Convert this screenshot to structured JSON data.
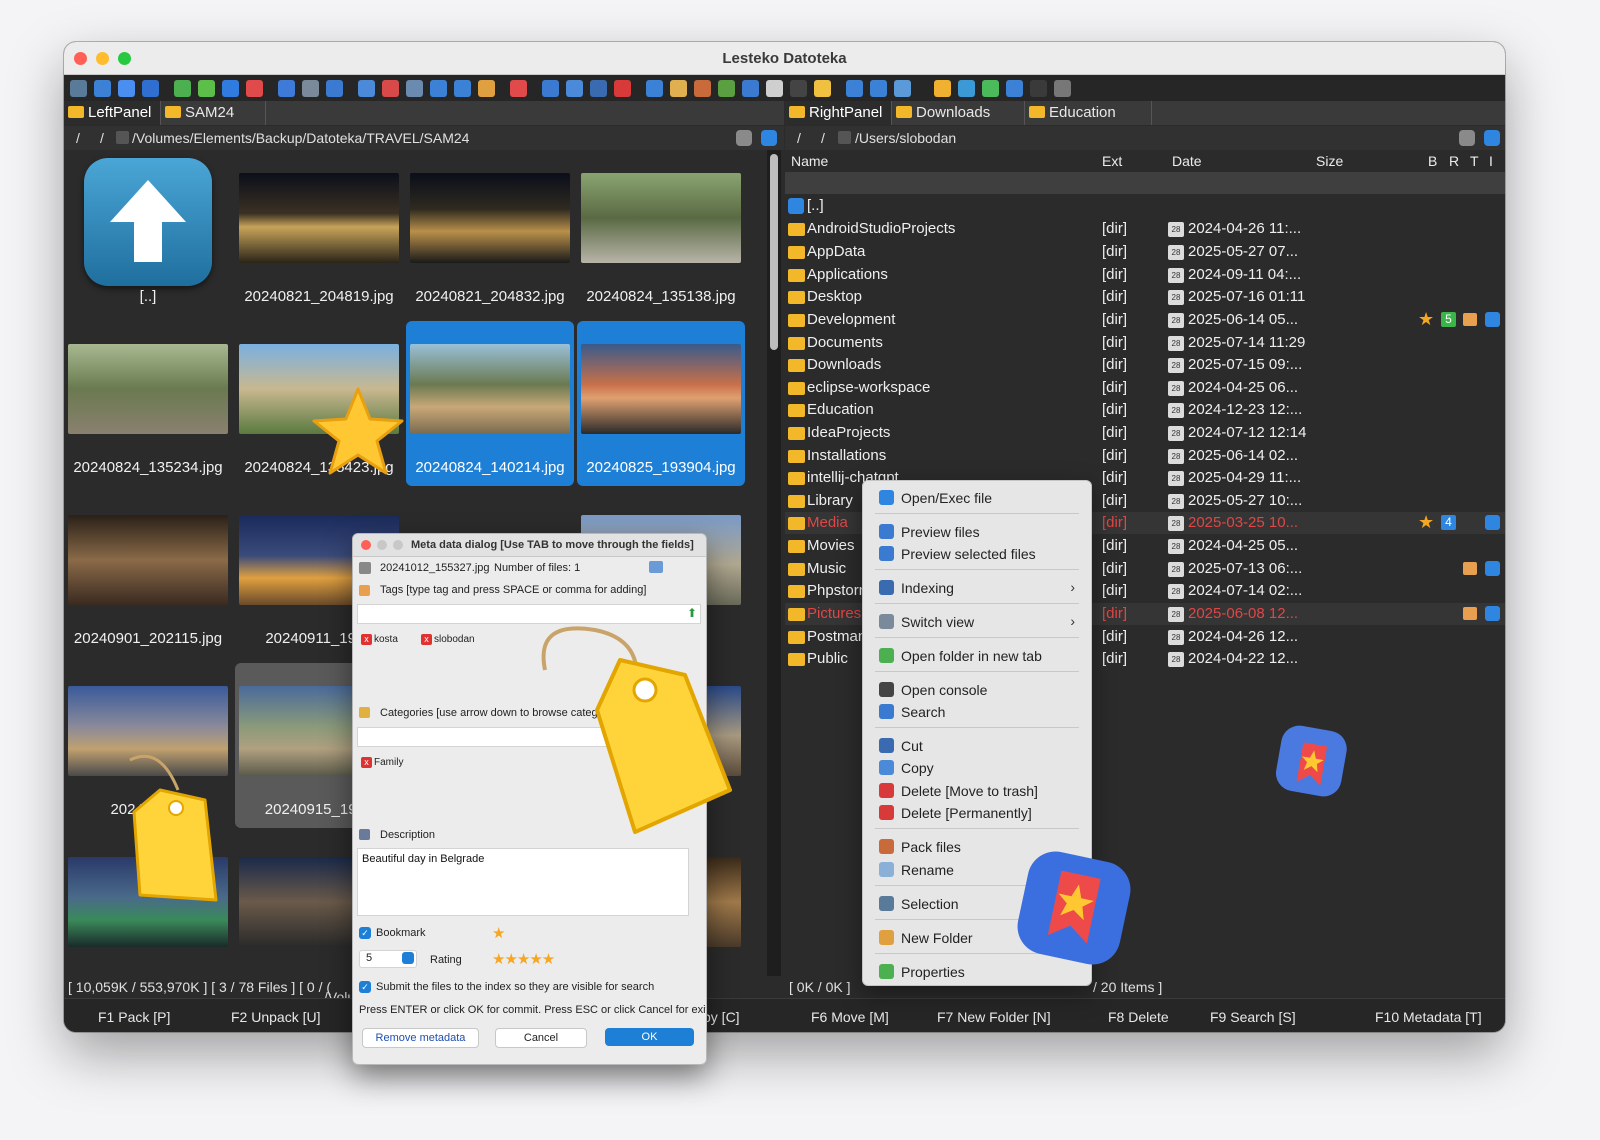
{
  "window": {
    "title": "Lesteko Datoteka"
  },
  "left": {
    "tabs": [
      "LeftPanel",
      "SAM24"
    ],
    "path_root": "/",
    "path_up": "/",
    "path": "/Volumes/Elements/Backup/Datoteka/TRAVEL/SAM24",
    "thumbnails": [
      {
        "name": "[..]"
      },
      {
        "name": "20240821_204819.jpg"
      },
      {
        "name": "20240821_204832.jpg"
      },
      {
        "name": "20240824_135138.jpg"
      },
      {
        "name": "20240824_135234.jpg"
      },
      {
        "name": "20240824_135423.jpg"
      },
      {
        "name": "20240824_140214.jpg"
      },
      {
        "name": "20240825_193904.jpg"
      },
      {
        "name": "20240901_202115.jpg"
      },
      {
        "name": "20240911_1928"
      },
      {
        "name": ""
      },
      {
        "name": "0.jpg"
      },
      {
        "name": "20240915_"
      },
      {
        "name": "20240915_1923"
      },
      {
        "name": ""
      },
      {
        "name": "0.jpg"
      }
    ],
    "status": "[ 10,059K / 553,970K ]    [ 3 / 78 Files ]    [ 0 / (",
    "status2": "/Volu"
  },
  "right": {
    "tabs": [
      "RightPanel",
      "Downloads",
      "Education"
    ],
    "path_root": "/",
    "path_up": "/",
    "path": "/Users/slobodan",
    "columns": {
      "name": "Name",
      "ext": "Ext",
      "date": "Date",
      "size": "Size",
      "b": "B",
      "r": "R",
      "t": "T",
      "i": "I"
    },
    "parent": "[..]",
    "rows": [
      {
        "name": "AndroidStudioProjects",
        "ext": "[dir]",
        "date": "2024-04-26 11:..."
      },
      {
        "name": "AppData",
        "ext": "[dir]",
        "date": "2025-05-27 07..."
      },
      {
        "name": "Applications",
        "ext": "[dir]",
        "date": "2024-09-11 04:..."
      },
      {
        "name": "Desktop",
        "ext": "[dir]",
        "date": "2025-07-16 01:11"
      },
      {
        "name": "Development",
        "ext": "[dir]",
        "date": "2025-06-14 05...",
        "rating": "5"
      },
      {
        "name": "Documents",
        "ext": "[dir]",
        "date": "2025-07-14 11:29"
      },
      {
        "name": "Downloads",
        "ext": "[dir]",
        "date": "2025-07-15 09:..."
      },
      {
        "name": "eclipse-workspace",
        "ext": "[dir]",
        "date": "2024-04-25 06..."
      },
      {
        "name": "Education",
        "ext": "[dir]",
        "date": "2024-12-23 12:..."
      },
      {
        "name": "IdeaProjects",
        "ext": "[dir]",
        "date": "2024-07-12 12:14"
      },
      {
        "name": "Installations",
        "ext": "[dir]",
        "date": "2025-06-14 02..."
      },
      {
        "name": "intellij-chatgpt",
        "ext": "[dir]",
        "date": "2025-04-29 11:..."
      },
      {
        "name": "Library",
        "ext": "[dir]",
        "date": "2025-05-27 10:..."
      },
      {
        "name": "Media",
        "ext": "[dir]",
        "date": "2025-03-25 10...",
        "rating": "4"
      },
      {
        "name": "Movies",
        "ext": "[dir]",
        "date": "2024-04-25 05..."
      },
      {
        "name": "Music",
        "ext": "[dir]",
        "date": "2025-07-13 06:..."
      },
      {
        "name": "Phpstorm",
        "ext": "[dir]",
        "date": "2024-07-14 02:..."
      },
      {
        "name": "Pictures",
        "ext": "[dir]",
        "date": "2025-06-08 12..."
      },
      {
        "name": "Postman",
        "ext": "[dir]",
        "date": "2024-04-26 12..."
      },
      {
        "name": "Public",
        "ext": "[dir]",
        "date": "2024-04-22 12..."
      }
    ],
    "status_left": "[ 0K / 0K ]",
    "status_right": "/ 20 Items ]"
  },
  "context_menu": {
    "open_exec": "Open/Exec file",
    "preview": "Preview files",
    "preview_selected": "Preview selected files",
    "indexing": "Indexing",
    "switch_view": "Switch view",
    "open_new_tab": "Open folder in new tab",
    "open_console": "Open console",
    "search": "Search",
    "cut": "Cut",
    "copy": "Copy",
    "delete_trash": "Delete [Move to trash]",
    "delete_perm": "Delete [Permanently]",
    "pack": "Pack files",
    "rename": "Rename",
    "selection": "Selection",
    "new_folder": "New Folder",
    "properties": "Properties"
  },
  "dialog": {
    "title": "Meta data dialog [Use TAB to move through the fields]",
    "file": "20241012_155327.jpg",
    "count": "Number of files: 1",
    "tags_label": "Tags [type tag and press SPACE or comma for adding]",
    "tags": [
      "kosta",
      "slobodan"
    ],
    "categories_label": "Categories [use arrow down to browse catego",
    "category": "Family",
    "description_label": "Description",
    "description": "Beautiful day in Belgrade",
    "bookmark_label": "Bookmark",
    "rating_value": "5",
    "rating_label": "Rating",
    "submit_label": "Submit the files to the index so they are visible for search",
    "hint": "Press ENTER or click OK for commit. Press ESC or click Cancel for exit.",
    "remove": "Remove metadata",
    "cancel": "Cancel",
    "ok": "OK"
  },
  "fkeys": {
    "f1": "F1 Pack [P]",
    "f2": "F2 Unpack [U]",
    "f5": "py [C]",
    "f6": "F6 Move [M]",
    "f7": "F7 New Folder [N]",
    "f8": "F8 Delete",
    "f9": "F9 Search [S]",
    "f10": "F10 Metadata [T]"
  },
  "colors": {
    "accent": "#1e7fd6",
    "folder": "#f3b82a",
    "highlight_red": "#e04646",
    "star": "#f5a623"
  }
}
